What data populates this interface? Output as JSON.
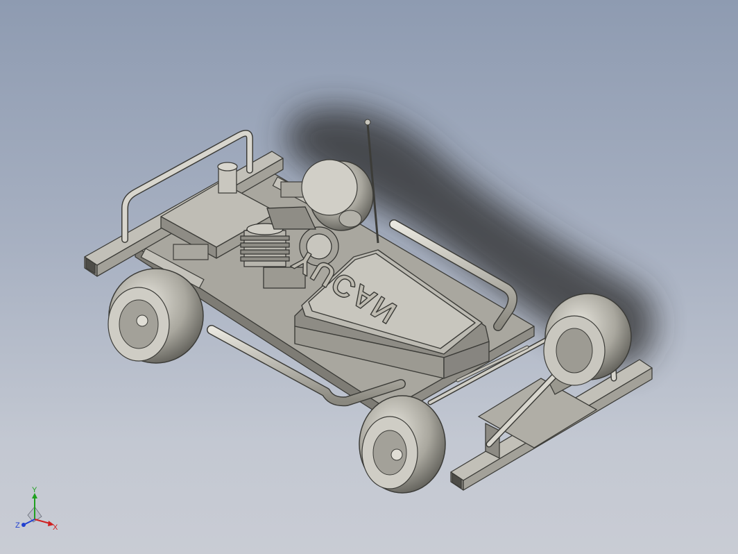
{
  "viewport": {
    "background_top": "#8e9bb1",
    "background_bottom": "#c9ccd4"
  },
  "model": {
    "logo_text": "YUCAN",
    "part_color": "#b9b7ad",
    "edge_color": "#3c3c38"
  },
  "triad": {
    "x_label": "X",
    "y_label": "Y",
    "z_label": "Z",
    "x_color": "#d02020",
    "y_color": "#20a020",
    "z_color": "#2040d0"
  }
}
